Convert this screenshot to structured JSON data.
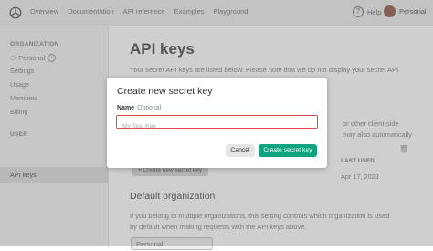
{
  "nav": {
    "items": [
      "Overview",
      "Documentation",
      "API reference",
      "Examples",
      "Playground"
    ],
    "help": "Help",
    "profile": "Personal"
  },
  "sidebar": {
    "org_header": "ORGANIZATION",
    "org_name": "Personal",
    "org_items": [
      "Settings",
      "Usage",
      "Members",
      "Billing"
    ],
    "user_header": "USER",
    "user_items": [
      "API keys"
    ]
  },
  "main": {
    "title": "API keys",
    "intro_line1": "Your secret API keys are listed below. Please note that we do not display your secret API",
    "side_text1": "or other client-side",
    "side_text2": "may also automatically",
    "last_used_header": "LAST USED",
    "last_used_value": "Apr 17, 2023",
    "create_button": "+ Create new secret key",
    "default_org_title": "Default organization",
    "default_org_text1": "If you belong to multiple organizations, this setting controls which organization is used",
    "default_org_text2": "by default when making requests with the API keys above.",
    "default_org_select": "Personal"
  },
  "modal": {
    "title": "Create new secret key",
    "name_label": "Name",
    "optional_label": "Optional",
    "placeholder": "My Test Key",
    "value": "",
    "cancel": "Cancel",
    "submit": "Create secret key",
    "colors": {
      "error_border": "#e0484f",
      "primary": "#10a37f"
    }
  }
}
